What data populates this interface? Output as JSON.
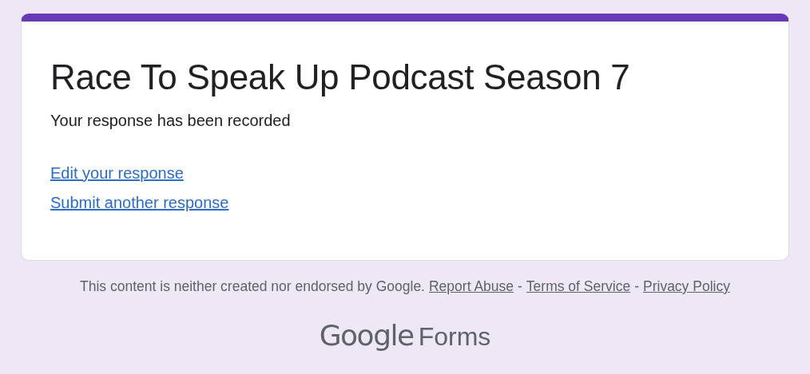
{
  "form": {
    "title": "Race To Speak Up Podcast Season 7",
    "message": "Your response has been recorded",
    "links": [
      {
        "label": "Edit your response"
      },
      {
        "label": "Submit another response"
      }
    ]
  },
  "footer": {
    "notice": "This content is neither created nor endorsed by Google.",
    "items": [
      {
        "kind": "link",
        "text": "Report Abuse"
      },
      {
        "kind": "separator",
        "text": "-"
      },
      {
        "kind": "link",
        "text": "Terms of Service"
      },
      {
        "kind": "separator",
        "text": "-"
      },
      {
        "kind": "link",
        "text": "Privacy Policy"
      }
    ]
  },
  "logo": {
    "brand": "Google",
    "product": "Forms"
  }
}
